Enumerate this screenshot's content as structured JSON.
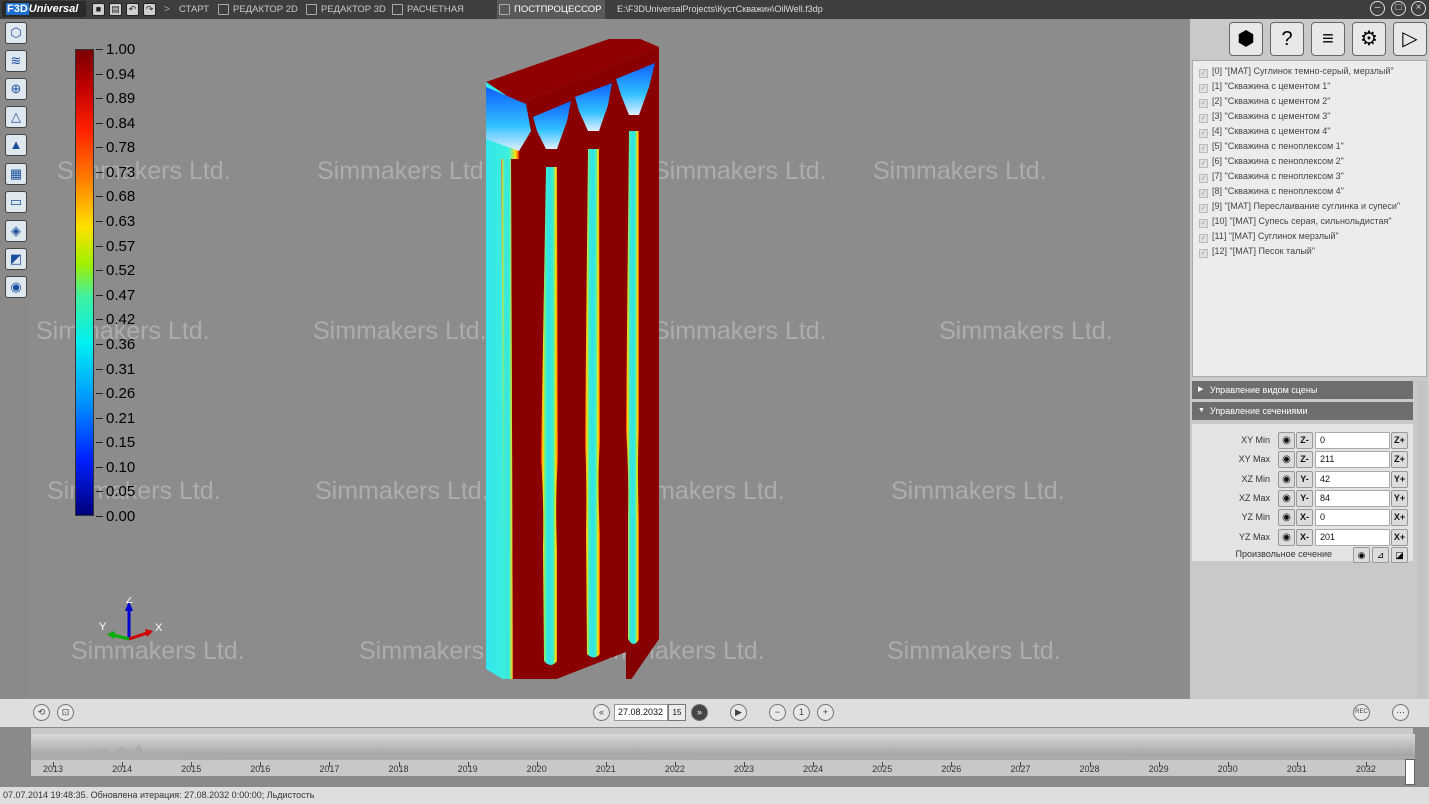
{
  "app": {
    "logo_prefix": "F3D",
    "logo_rest": "Universal",
    "file_path": "E:\\F3DUniversalProjects\\КустСкважин\\OilWell.f3dp"
  },
  "tabs": [
    {
      "label": "СТАРТ",
      "active": false
    },
    {
      "label": "РЕДАКТОР 2D",
      "active": false
    },
    {
      "label": "РЕДАКТОР 3D",
      "active": false
    },
    {
      "label": "РАСЧЕТНАЯ СЕТКА",
      "active": false
    },
    {
      "label": "ПОСТПРОЦЕССОР",
      "active": true
    }
  ],
  "watermark": "Simmakers Ltd.",
  "colorbar": {
    "ticks": [
      "1.00",
      "0.94",
      "0.89",
      "0.84",
      "0.78",
      "0.73",
      "0.68",
      "0.63",
      "0.57",
      "0.52",
      "0.47",
      "0.42",
      "0.36",
      "0.31",
      "0.26",
      "0.21",
      "0.15",
      "0.10",
      "0.05",
      "0.00"
    ]
  },
  "axes": {
    "z": "Z",
    "y": "Y",
    "x": "X"
  },
  "materials": [
    "[0] \"[MAT] Суглинок темно-серый, мерзлый\"",
    "[1] \"Скважина с цементом 1\"",
    "[2] \"Скважина с цементом 2\"",
    "[3] \"Скважина с цементом 3\"",
    "[4] \"Скважина с цементом 4\"",
    "[5] \"Скважина с пеноплексом 1\"",
    "[6] \"Скважина с пеноплексом 2\"",
    "[7] \"Скважина с пеноплексом 3\"",
    "[8] \"Скважина с пеноплексом 4\"",
    "[9] \"[MAT] Переслаивание суглинка и супеси\"",
    "[10] \"[MAT] Супесь серая, сильнольдистая\"",
    "[11] \"[MAT] Суглинок мерзлый\"",
    "[12] \"[MAT] Песок талый\""
  ],
  "sections": {
    "scene_view": "Управление видом сцены",
    "cuts": "Управление сечениями"
  },
  "cuts": [
    {
      "label": "XY Min",
      "minus": "Z-",
      "value": "0",
      "plus": "Z+"
    },
    {
      "label": "XY Max",
      "minus": "Z-",
      "value": "211",
      "plus": "Z+"
    },
    {
      "label": "XZ Min",
      "minus": "Y-",
      "value": "42",
      "plus": "Y+"
    },
    {
      "label": "XZ Max",
      "minus": "Y-",
      "value": "84",
      "plus": "Y+"
    },
    {
      "label": "YZ Min",
      "minus": "X-",
      "value": "0",
      "plus": "X+"
    },
    {
      "label": "YZ Max",
      "minus": "X-",
      "value": "201",
      "plus": "X+"
    }
  ],
  "arbitrary_cut": "Произвольное сечение",
  "time": {
    "date": "27.08.2032",
    "step": "1",
    "cal_label": "15",
    "rec": "REC"
  },
  "years": [
    "2013",
    "2014",
    "2015",
    "2016",
    "2017",
    "2018",
    "2019",
    "2020",
    "2021",
    "2022",
    "2023",
    "2024",
    "2025",
    "2026",
    "2027",
    "2028",
    "2029",
    "2030",
    "2031",
    "2032"
  ],
  "status": "07.07.2014 19:48:35. Обновлена итерация: 27.08.2032 0:00:00; Льдистость"
}
